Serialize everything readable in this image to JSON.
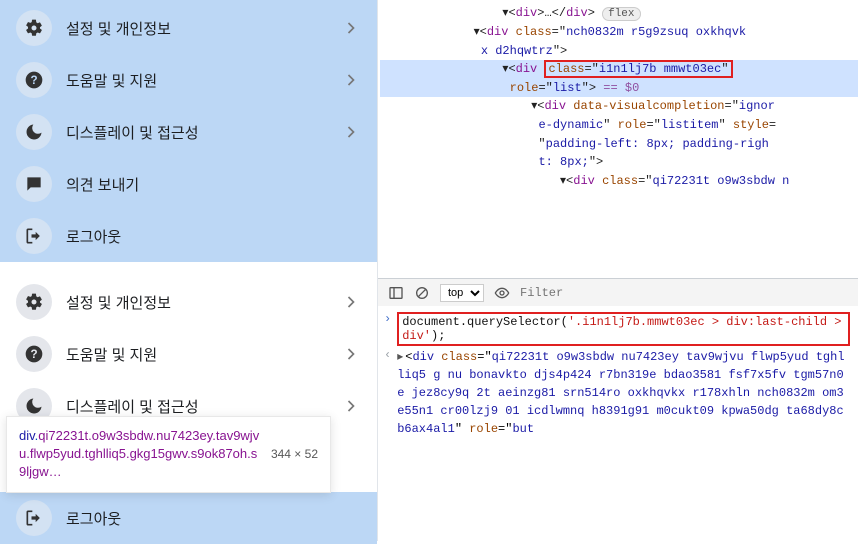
{
  "menu_top": {
    "items": [
      {
        "label": "설정 및 개인정보",
        "icon": "gear",
        "has_chevron": true
      },
      {
        "label": "도움말 및 지원",
        "icon": "question",
        "has_chevron": true
      },
      {
        "label": "디스플레이 및 접근성",
        "icon": "moon",
        "has_chevron": true
      },
      {
        "label": "의견 보내기",
        "icon": "feedback",
        "has_chevron": false
      },
      {
        "label": "로그아웃",
        "icon": "logout",
        "has_chevron": false
      }
    ]
  },
  "menu_bottom": {
    "items": [
      {
        "label": "설정 및 개인정보",
        "icon": "gear",
        "has_chevron": true
      },
      {
        "label": "도움말 및 지원",
        "icon": "question",
        "has_chevron": true
      },
      {
        "label": "디스플레이 및 접근성",
        "icon": "moon",
        "has_chevron": true
      },
      {
        "label": "로그아웃",
        "icon": "logout",
        "has_chevron": false,
        "active": true
      }
    ]
  },
  "tooltip": {
    "tag": "div",
    "classes": "qi72231t.o9w3sbdw.nu7423ey.tav9wjvu.flwp5yud.tghlliq5.gkg15gwv.s9ok87oh.s9ljgw…",
    "dimensions": "344 × 52"
  },
  "elements": {
    "lines": [
      {
        "indent": 62,
        "raw": "▾<div>…</div> (flex)"
      },
      {
        "indent": 48,
        "raw": "▾<div class=\"nch0832m r5g9zsuq oxkhqvkx d2hqwtrz\">"
      },
      {
        "indent": 62,
        "raw": "▾<div [class=\"i1n1lj7b mmwt03ec\"] role=\"list\"> == $0"
      },
      {
        "indent": 76,
        "raw": "▾<div data-visualcompletion=\"ignore-dynamic\" role=\"listitem\" style=\"padding-left: 8px; padding-right: 8px;\">"
      },
      {
        "indent": 90,
        "raw": "▾<div class=\"qi72231t o9w3sbdw n"
      }
    ],
    "highlighted_attr": "class=\"i1n1lj7b mmwt03ec\""
  },
  "console": {
    "context": "top",
    "filter_placeholder": "Filter",
    "command": "document.querySelector('.i1n1lj7b.mmwt03ec > div:last-child > div');",
    "output_preview": "▸<div class=\"qi72231t o9w3sbdw nu7423ey tav9wjvu flwp5yud tghlliq5 gnu bonavkto djs4p424 r7bn319e bdao3581 fsf7x5fv tgm57n0e jez8cy9q 2t aeinzg81 srn514ro oxkhqvkx r178xhln nch0832m om3e55n1 cr00lzj9 01 icdlwmnq h8391g91 m0cukt09 kpwa50dg ta68dy8c b6ax4al1\" role=\"but"
  }
}
